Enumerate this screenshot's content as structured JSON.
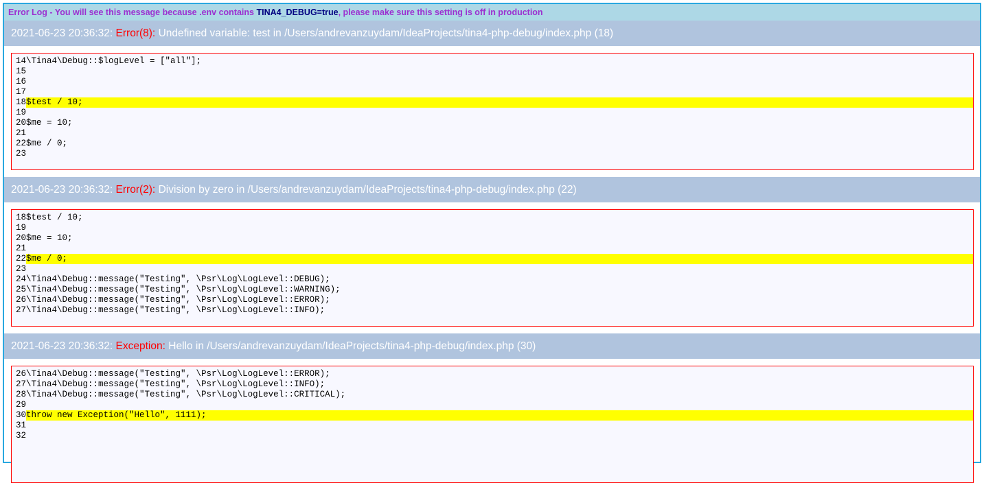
{
  "banner": {
    "part1": "Error Log - You will see this message because .env contains ",
    "part2": "TINA4_DEBUG=true",
    "part3": ", please make sure this setting is off in production"
  },
  "errors": [
    {
      "timestamp": "2021-06-23 20:36:32:",
      "type": "Error(8):",
      "message": "Undefined variable: test in /Users/andrevanzuydam/IdeaProjects/tina4-php-debug/index.php (18)",
      "lines": [
        {
          "num": "14",
          "code": "\\Tina4\\Debug::$logLevel = [\"all\"];",
          "highlight": false
        },
        {
          "num": "15",
          "code": "",
          "highlight": false
        },
        {
          "num": "16",
          "code": "",
          "highlight": false
        },
        {
          "num": "17",
          "code": "",
          "highlight": false
        },
        {
          "num": "18",
          "code": "$test / 10;",
          "highlight": true
        },
        {
          "num": "19",
          "code": "",
          "highlight": false
        },
        {
          "num": "20",
          "code": "$me = 10;",
          "highlight": false
        },
        {
          "num": "21",
          "code": "",
          "highlight": false
        },
        {
          "num": "22",
          "code": "$me / 0;",
          "highlight": false
        },
        {
          "num": "23",
          "code": "",
          "highlight": false
        }
      ]
    },
    {
      "timestamp": "2021-06-23 20:36:32:",
      "type": "Error(2):",
      "message": "Division by zero in /Users/andrevanzuydam/IdeaProjects/tina4-php-debug/index.php (22)",
      "lines": [
        {
          "num": "18",
          "code": "$test / 10;",
          "highlight": false
        },
        {
          "num": "19",
          "code": "",
          "highlight": false
        },
        {
          "num": "20",
          "code": "$me = 10;",
          "highlight": false
        },
        {
          "num": "21",
          "code": "",
          "highlight": false
        },
        {
          "num": "22",
          "code": "$me / 0;",
          "highlight": true
        },
        {
          "num": "23",
          "code": "",
          "highlight": false
        },
        {
          "num": "24",
          "code": "\\Tina4\\Debug::message(\"Testing\", \\Psr\\Log\\LogLevel::DEBUG);",
          "highlight": false
        },
        {
          "num": "25",
          "code": "\\Tina4\\Debug::message(\"Testing\", \\Psr\\Log\\LogLevel::WARNING);",
          "highlight": false
        },
        {
          "num": "26",
          "code": "\\Tina4\\Debug::message(\"Testing\", \\Psr\\Log\\LogLevel::ERROR);",
          "highlight": false
        },
        {
          "num": "27",
          "code": "\\Tina4\\Debug::message(\"Testing\", \\Psr\\Log\\LogLevel::INFO);",
          "highlight": false
        }
      ]
    },
    {
      "timestamp": "2021-06-23 20:36:32:",
      "type": "Exception:",
      "message": "Hello in /Users/andrevanzuydam/IdeaProjects/tina4-php-debug/index.php (30)",
      "lines": [
        {
          "num": "26",
          "code": "\\Tina4\\Debug::message(\"Testing\", \\Psr\\Log\\LogLevel::ERROR);",
          "highlight": false
        },
        {
          "num": "27",
          "code": "\\Tina4\\Debug::message(\"Testing\", \\Psr\\Log\\LogLevel::INFO);",
          "highlight": false
        },
        {
          "num": "28",
          "code": "\\Tina4\\Debug::message(\"Testing\", \\Psr\\Log\\LogLevel::CRITICAL);",
          "highlight": false
        },
        {
          "num": "29",
          "code": "",
          "highlight": false
        },
        {
          "num": "30",
          "code": "throw new Exception(\"Hello\", 1111);",
          "highlight": true
        },
        {
          "num": "31",
          "code": "",
          "highlight": false
        },
        {
          "num": "32",
          "code": "",
          "highlight": false
        }
      ]
    }
  ],
  "colors": {
    "border": "#29a8e0",
    "banner_bg": "#add8e6",
    "banner_text": "#9b30d0",
    "banner_emphasis": "#000080",
    "header_bg": "#b0c4de",
    "header_text": "#ffffff",
    "error_type": "#ff0000",
    "code_border": "#ff0000",
    "code_bg": "#f8f8ff",
    "highlight": "#ffff00"
  }
}
